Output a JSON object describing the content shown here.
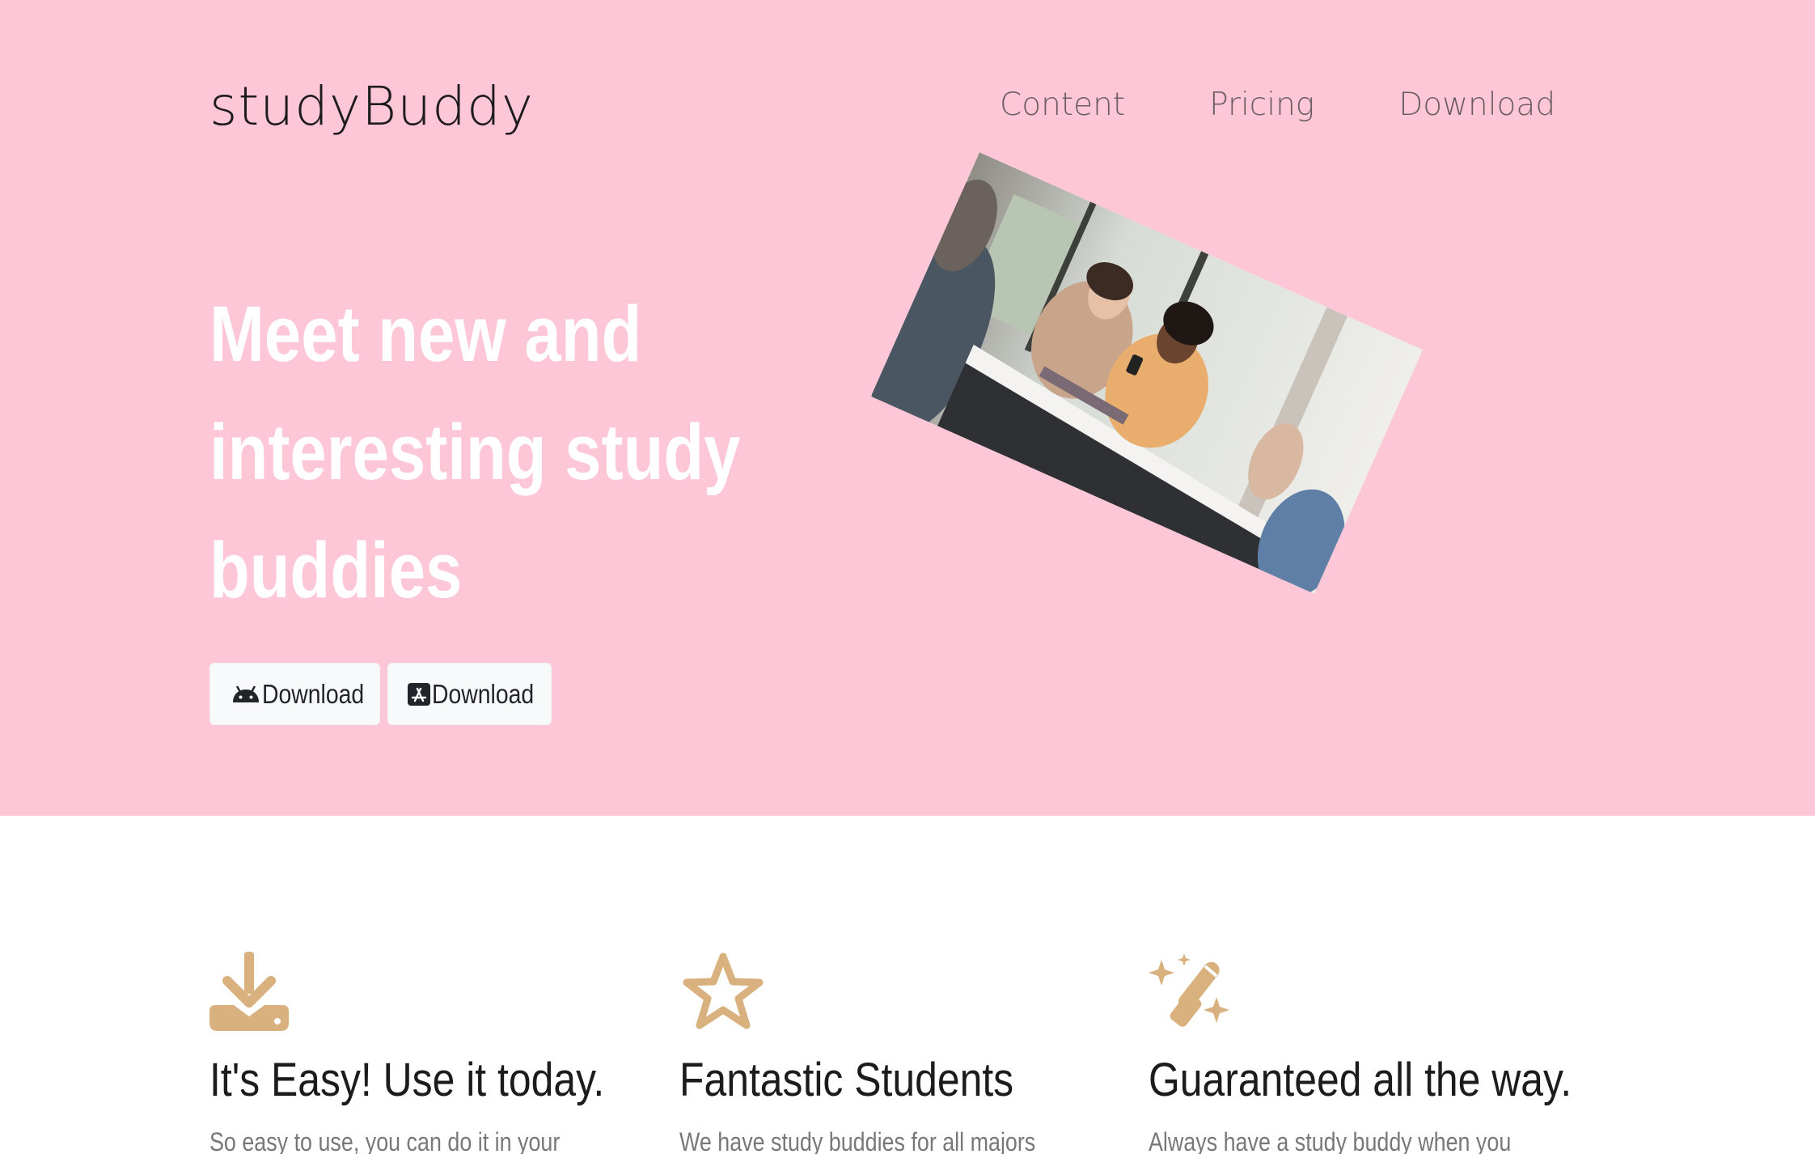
{
  "header": {
    "brand": "studyBuddy",
    "nav": [
      "Content",
      "Pricing",
      "Download"
    ]
  },
  "hero": {
    "title_line1": "Meet new and",
    "title_line2": "interesting study",
    "title_line3": "buddies",
    "buttons": [
      {
        "label": "Download",
        "icon": "android-icon"
      },
      {
        "label": "Download",
        "icon": "app-store-icon"
      }
    ],
    "image_alt": "two students laughing at a table looking at a phone"
  },
  "features": [
    {
      "icon": "download-tray-icon",
      "title": "It's Easy! Use it today.",
      "text": "So easy to use, you can do it in your"
    },
    {
      "icon": "star-icon",
      "title": "Fantastic Students",
      "text": "We have study buddies for all majors"
    },
    {
      "icon": "magic-wand-icon",
      "title": "Guaranteed all the way.",
      "text": "Always have a study buddy when you"
    }
  ],
  "colors": {
    "hero_bg": "#fec7d7",
    "icon_tan": "#d9b17e",
    "button_bg": "#f8f9fa"
  }
}
